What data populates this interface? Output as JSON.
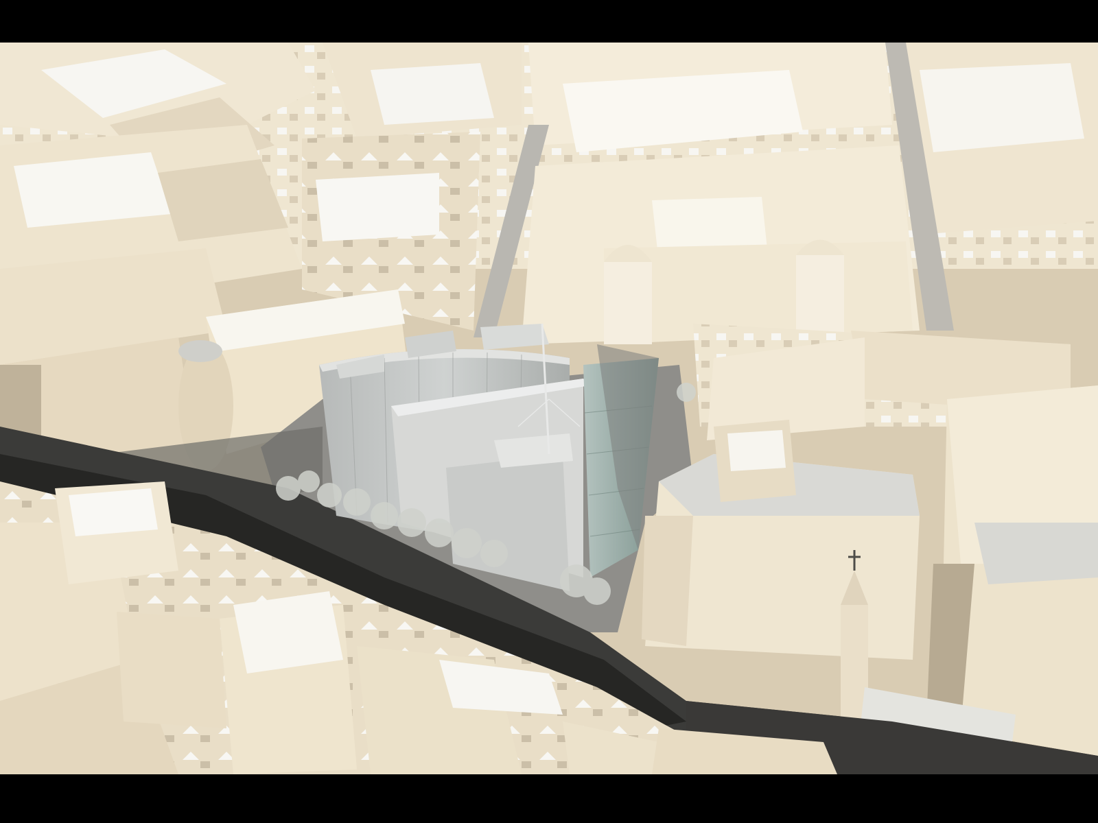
{
  "image": {
    "description_icon": "aerial-city-render-icon",
    "colors": {
      "letterbox": "#000000",
      "building_light": "#f3ead6",
      "building_mid": "#e4d7bf",
      "building_shadow": "#b9ac95",
      "roof_light": "#f1f1ee",
      "roof_grey": "#d7d7d2",
      "street": "#2c2c2a",
      "street_shadow": "#505050",
      "pavement": "#8a8a86",
      "glass_building": "#c9cccb",
      "glass_building_dark": "#a9adab",
      "glass_facade": "#9cb5ad",
      "trees": "#cfd2cc"
    }
  }
}
